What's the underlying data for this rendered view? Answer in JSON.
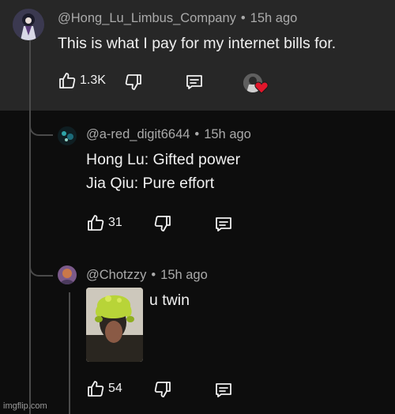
{
  "comments": [
    {
      "username": "@Hong_Lu_Limbus_Company",
      "time": "15h ago",
      "lines": [
        "This is what I pay for my internet bills for."
      ],
      "likes": "1.3K"
    },
    {
      "username": "@a-red_digit6644",
      "time": "15h ago",
      "lines": [
        "Hong Lu: Gifted power",
        "Jia Qiu: Pure effort"
      ],
      "likes": "31"
    },
    {
      "username": "@Chotzzy",
      "time": "15h ago",
      "lines": [
        "u twin"
      ],
      "likes": "54"
    }
  ],
  "separator": "•",
  "watermark": "imgflip.com",
  "colors": {
    "top_background": "#272727",
    "page_background": "#0d0d0d",
    "meta_text": "#aaaaaa",
    "heart": "#e0162b"
  }
}
